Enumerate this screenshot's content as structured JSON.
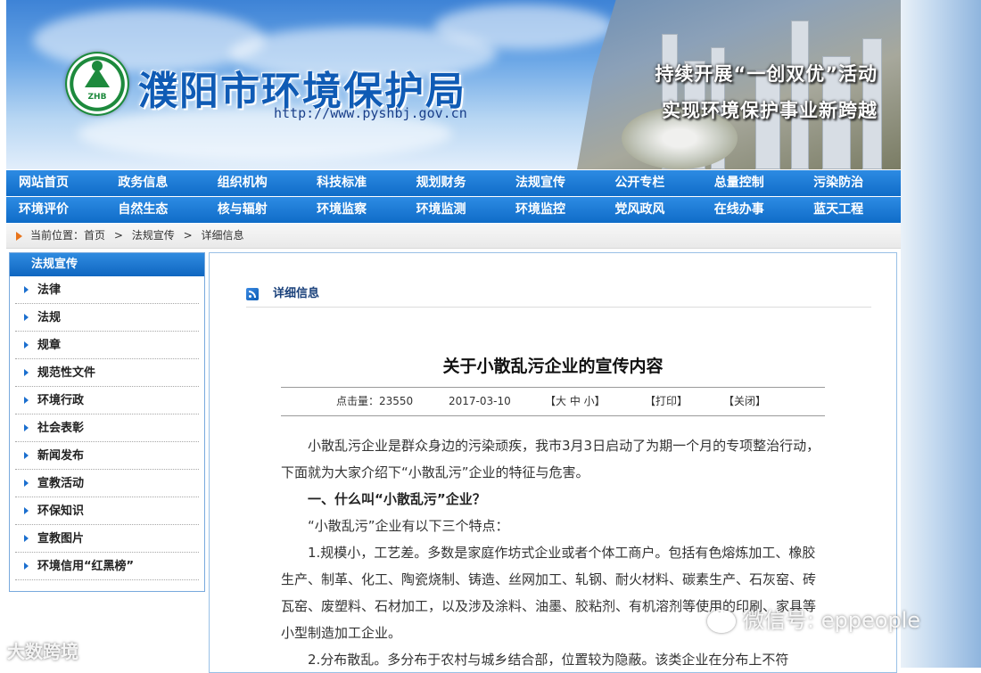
{
  "banner": {
    "logo_text": "ZHB",
    "title": "濮阳市环境保护局",
    "url": "http://www.pyshbj.gov.cn",
    "slogan_1": "持续开展“一创双优”活动",
    "slogan_2": "实现环境保护事业新跨越"
  },
  "nav": {
    "row1": [
      "网站首页",
      "政务信息",
      "组织机构",
      "科技标准",
      "规划财务",
      "法规宣传",
      "公开专栏",
      "总量控制",
      "污染防治"
    ],
    "row2": [
      "环境评价",
      "自然生态",
      "核与辐射",
      "环境监察",
      "环境监测",
      "环境监控",
      "党风政风",
      "在线办事",
      "蓝天工程"
    ]
  },
  "breadcrumb": {
    "prefix": "当前位置：首页",
    "sep": ">",
    "level1": "法规宣传",
    "level2": "详细信息"
  },
  "sidebar": {
    "title": "法规宣传",
    "items": [
      "法律",
      "法规",
      "规章",
      "规范性文件",
      "环境行政",
      "社会表彰",
      "新闻发布",
      "宣教活动",
      "环保知识",
      "宣教图片",
      "环境信用“红黑榜”"
    ]
  },
  "main": {
    "section_title": "详细信息",
    "article": {
      "title": "关于小散乱污企业的宣传内容",
      "clicks": "点击量：23550",
      "date": "2017-03-10",
      "font_size": "【大 中 小】",
      "print": "【打印】",
      "close": "【关闭】",
      "paragraphs": [
        "小散乱污企业是群众身边的污染顽疾，我市3月3日启动了为期一个月的专项整治行动，下面就为大家介绍下“小散乱污”企业的特征与危害。",
        "一、什么叫“小散乱污”企业？",
        "“小散乱污”企业有以下三个特点：",
        "1.规模小，工艺差。多数是家庭作坊式企业或者个体工商户。包括有色熔炼加工、橡胶生产、制革、化工、陶瓷烧制、铸造、丝网加工、轧钢、耐火材料、碳素生产、石灰窑、砖瓦窑、废塑料、石材加工，以及涉及涂料、油墨、胶粘剂、有机溶剂等使用的印刷、家具等小型制造加工企业。",
        "2.分布散乱。多分布于农村与城乡结合部，位置较为隐蔽。该类企业在分布上不符"
      ]
    }
  },
  "watermarks": {
    "wechat": "微信号: eppeople",
    "brand": "大数跨境"
  },
  "colors": {
    "nav_blue": "#0f6cc8",
    "title_blue": "#0f5bb5",
    "breadcrumb_arrow": "#e8731a"
  }
}
